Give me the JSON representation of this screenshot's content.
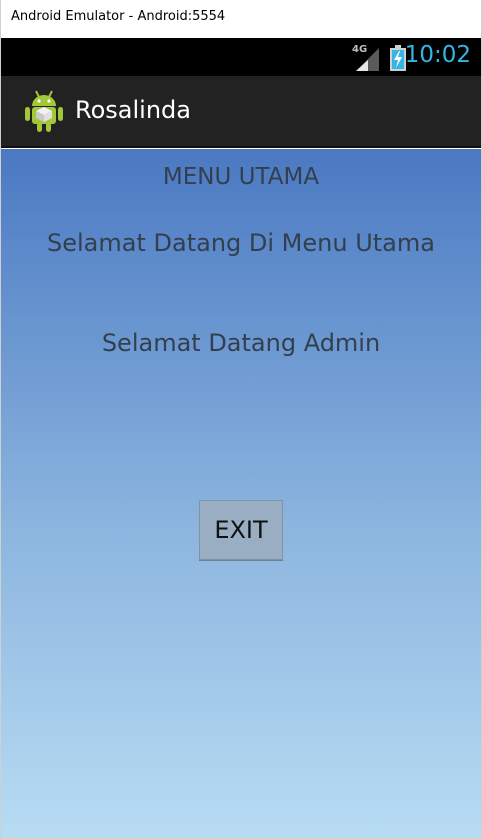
{
  "window": {
    "title": "Android Emulator - Android:5554"
  },
  "status_bar": {
    "network_label": "4G",
    "network_icon": "signal-icon",
    "battery_icon": "battery-charging-icon",
    "time": "10:02",
    "time_color": "#33b5e5"
  },
  "action_bar": {
    "icon": "android-robot-icon",
    "title": "Rosalinda"
  },
  "main": {
    "menu_title": "MENU UTAMA",
    "welcome_menu": "Selamat Datang Di Menu Utama",
    "welcome_admin": "Selamat Datang Admin",
    "exit_label": "EXIT"
  }
}
